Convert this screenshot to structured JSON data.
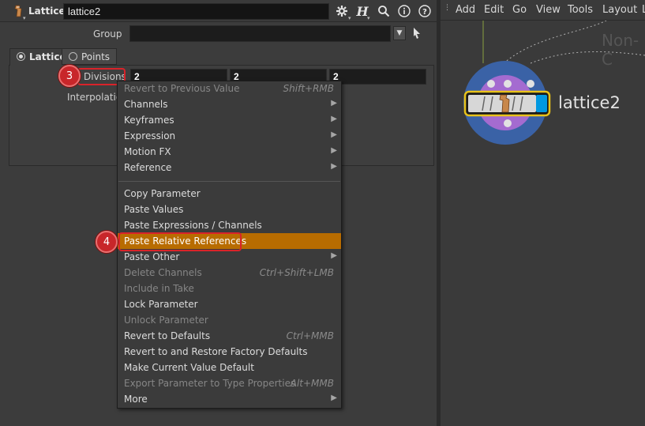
{
  "header": {
    "node_type": "Lattice",
    "node_name": "lattice2",
    "icons": [
      "gear-icon",
      "houdini-help-icon",
      "search-icon",
      "info-icon",
      "help-icon"
    ]
  },
  "params": {
    "group_label": "Group",
    "group_value": "",
    "tabs": [
      {
        "label": "Lattice",
        "selected": true
      },
      {
        "label": "Points",
        "selected": false
      }
    ],
    "divisions_label": "Divisions",
    "divisions_values": [
      "2",
      "2",
      "2"
    ],
    "interpolation_label": "Interpolation"
  },
  "callouts": [
    "3",
    "4"
  ],
  "context_menu": {
    "items": [
      {
        "label": "Revert to Previous Value",
        "shortcut": "Shift+RMB",
        "disabled": true,
        "submenu": false
      },
      {
        "label": "Channels",
        "shortcut": "",
        "disabled": false,
        "submenu": true
      },
      {
        "label": "Keyframes",
        "shortcut": "",
        "disabled": false,
        "submenu": true
      },
      {
        "label": "Expression",
        "shortcut": "",
        "disabled": false,
        "submenu": true
      },
      {
        "label": "Motion FX",
        "shortcut": "",
        "disabled": false,
        "submenu": true
      },
      {
        "label": "Reference",
        "shortcut": "",
        "disabled": false,
        "submenu": true
      },
      {
        "label": "Copy Parameter",
        "shortcut": "",
        "disabled": false,
        "submenu": false
      },
      {
        "label": "Paste Values",
        "shortcut": "",
        "disabled": false,
        "submenu": false
      },
      {
        "label": "Paste Expressions / Channels",
        "shortcut": "",
        "disabled": false,
        "submenu": false
      },
      {
        "label": "Paste Relative References",
        "shortcut": "",
        "disabled": false,
        "submenu": false,
        "highlighted": true
      },
      {
        "label": "Paste Other",
        "shortcut": "",
        "disabled": false,
        "submenu": true
      },
      {
        "label": "Delete Channels",
        "shortcut": "Ctrl+Shift+LMB",
        "disabled": true,
        "submenu": false
      },
      {
        "label": "Include in Take",
        "shortcut": "",
        "disabled": true,
        "submenu": false
      },
      {
        "label": "Lock Parameter",
        "shortcut": "",
        "disabled": false,
        "submenu": false
      },
      {
        "label": "Unlock Parameter",
        "shortcut": "",
        "disabled": true,
        "submenu": false
      },
      {
        "label": "Revert to Defaults",
        "shortcut": "Ctrl+MMB",
        "disabled": false,
        "submenu": false
      },
      {
        "label": "Revert to and Restore Factory Defaults",
        "shortcut": "",
        "disabled": false,
        "submenu": false
      },
      {
        "label": "Make Current Value Default",
        "shortcut": "",
        "disabled": false,
        "submenu": false
      },
      {
        "label": "Export Parameter to Type Properties",
        "shortcut": "Alt+MMB",
        "disabled": true,
        "submenu": false
      },
      {
        "label": "More",
        "shortcut": "",
        "disabled": false,
        "submenu": true
      }
    ]
  },
  "network": {
    "menus": [
      "Add",
      "Edit",
      "Go",
      "View",
      "Tools",
      "Layout",
      "L"
    ],
    "watermark": "Non-C",
    "node_label": "lattice2"
  },
  "colors": {
    "highlight": "#b86c00",
    "callout": "#d9232a",
    "node_ring_outer": "#3a62a6",
    "node_ring_inner": "#a46bd0",
    "node_selected_outline": "#e8c21a",
    "node_flag": "#0098e0"
  }
}
